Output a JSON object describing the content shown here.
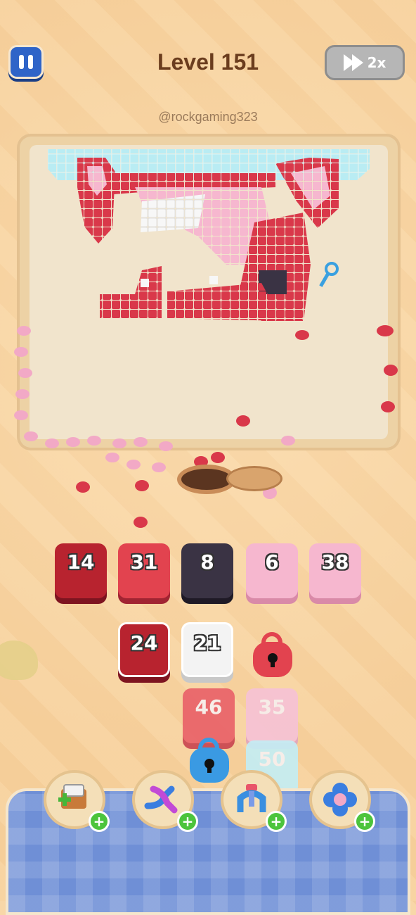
{
  "header": {
    "level_title": "Level 151",
    "speed_label": "2x",
    "handle": "@rockgaming323"
  },
  "colors": {
    "pause_button": "#2f64c8",
    "title": "#6b3d1e",
    "red": "#d9384a",
    "dark_red": "#b8232f",
    "pink": "#f6b7cf",
    "black": "#3a3344",
    "light_blue": "#b9ecf3",
    "white_tile": "#f3f3f3"
  },
  "tiles": {
    "row1": [
      {
        "value": "14",
        "color": "dark_red"
      },
      {
        "value": "31",
        "color": "red"
      },
      {
        "value": "8",
        "color": "black"
      },
      {
        "value": "6",
        "color": "pink"
      },
      {
        "value": "38",
        "color": "pink"
      }
    ],
    "row2": [
      {
        "value": "24",
        "color": "dark_red"
      },
      {
        "value": "21",
        "color": "white_tile"
      }
    ],
    "row3": [
      {
        "value": "46",
        "color": "red"
      },
      {
        "value": "35",
        "color": "pink"
      }
    ],
    "row4": [
      {
        "value": "50",
        "color": "light_blue"
      }
    ]
  },
  "locks": [
    {
      "name": "red-lock",
      "color": "red"
    },
    {
      "name": "blue-lock",
      "color": "blue"
    }
  ],
  "boosters": [
    {
      "name": "add-slot",
      "icon": "box-plus-icon"
    },
    {
      "name": "shuffle",
      "icon": "shuffle-arrows-icon"
    },
    {
      "name": "magnet",
      "icon": "magnet-icon"
    },
    {
      "name": "flower-bomb",
      "icon": "flower-icon"
    }
  ]
}
